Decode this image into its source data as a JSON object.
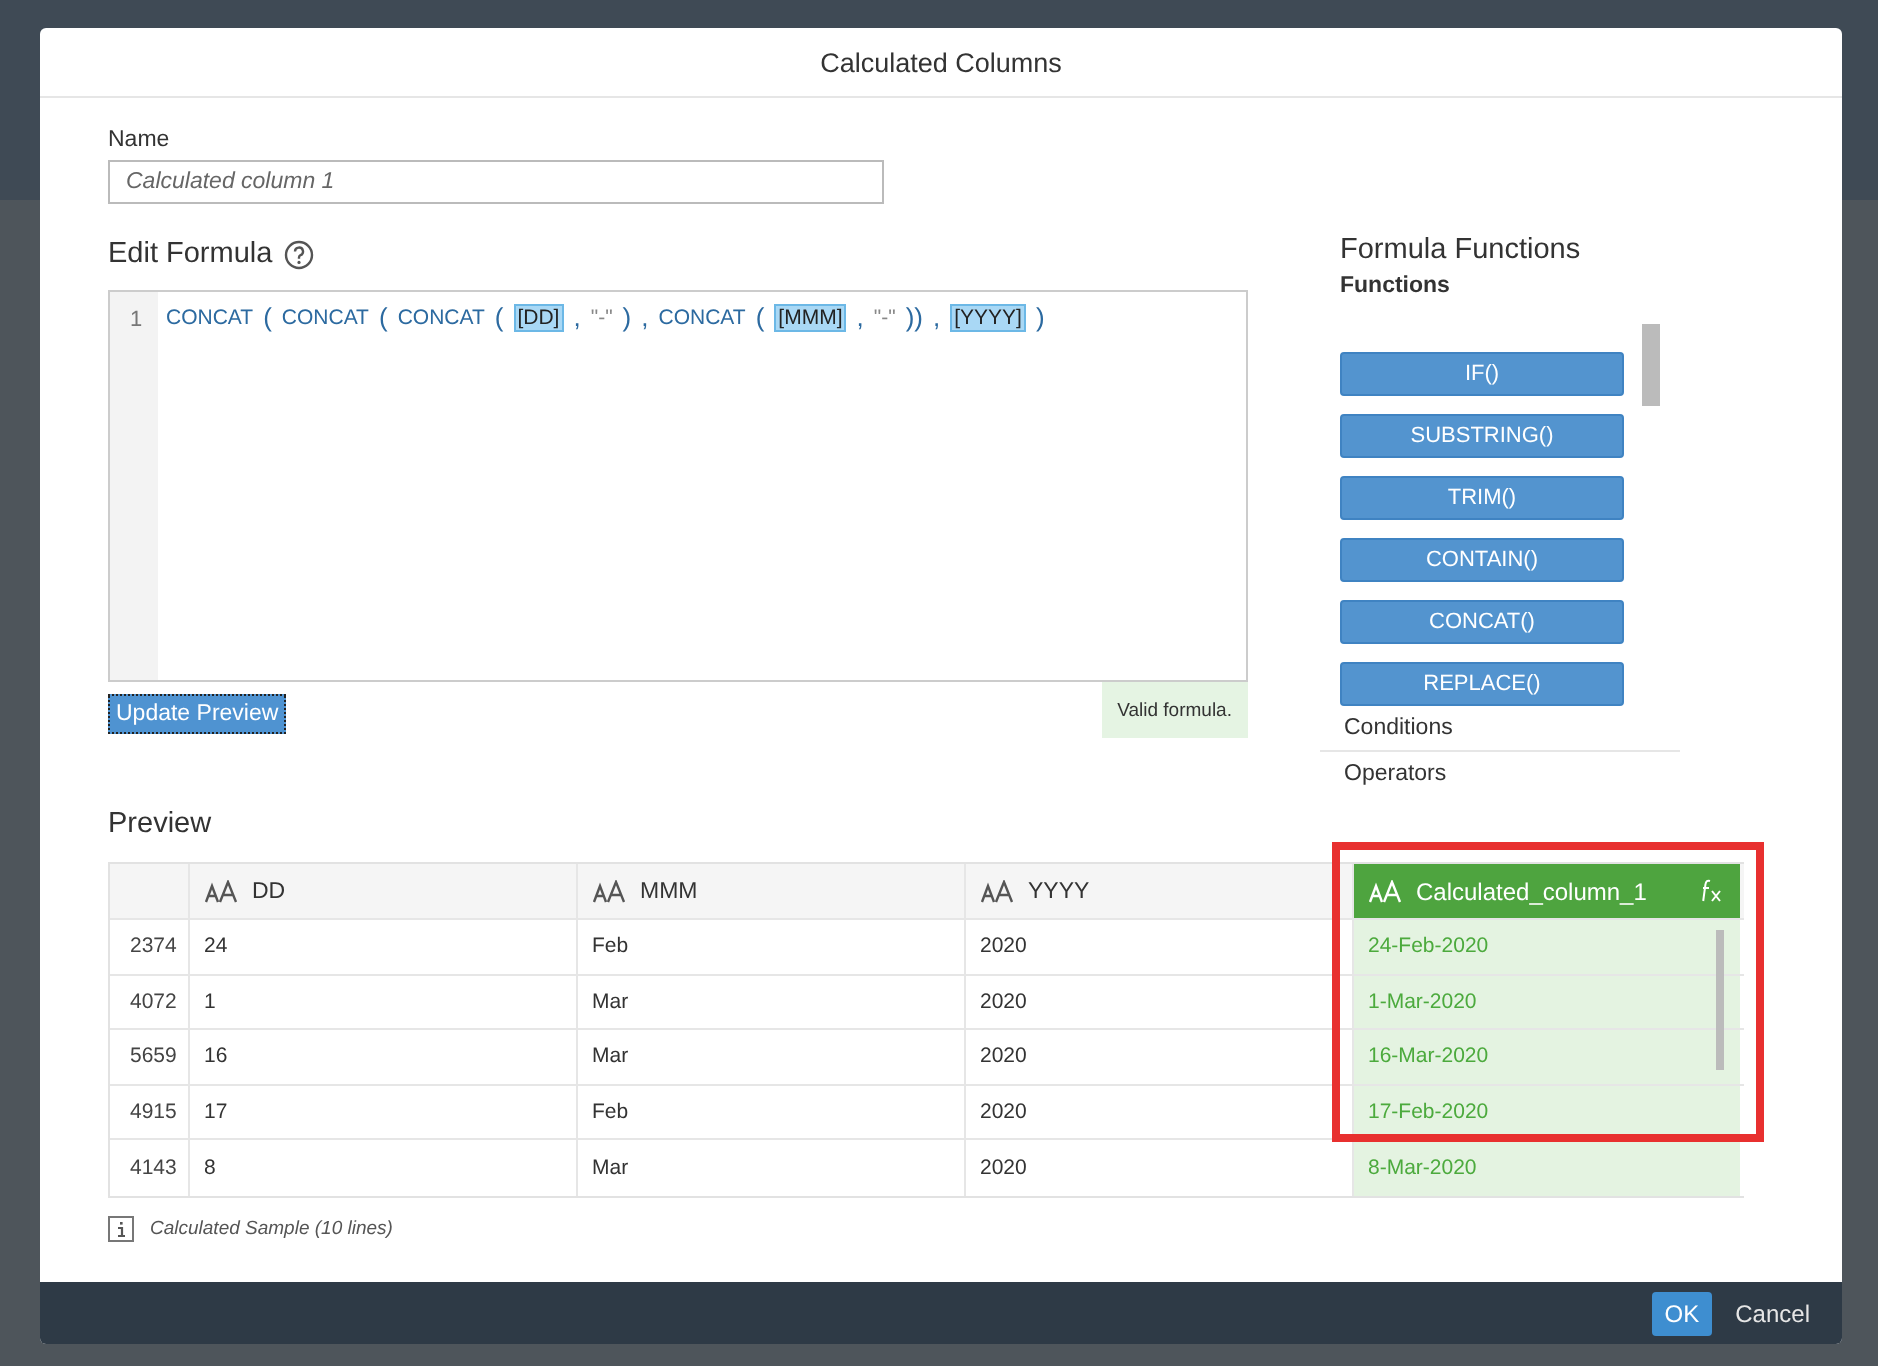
{
  "dialog": {
    "title": "Calculated Columns"
  },
  "name_field": {
    "label": "Name",
    "placeholder": "Calculated column 1"
  },
  "formula": {
    "heading": "Edit Formula",
    "line_number": "1",
    "tokens": [
      {
        "kind": "function",
        "text": "CONCAT"
      },
      {
        "kind": "punct",
        "text": "("
      },
      {
        "kind": "function",
        "text": "CONCAT"
      },
      {
        "kind": "punct",
        "text": "("
      },
      {
        "kind": "function",
        "text": "CONCAT"
      },
      {
        "kind": "punct",
        "text": "("
      },
      {
        "kind": "field",
        "text": "[DD]"
      },
      {
        "kind": "punct",
        "text": ","
      },
      {
        "kind": "string",
        "text": "\"-\""
      },
      {
        "kind": "punct",
        "text": ")"
      },
      {
        "kind": "punct",
        "text": ","
      },
      {
        "kind": "function",
        "text": "CONCAT"
      },
      {
        "kind": "punct",
        "text": "("
      },
      {
        "kind": "field",
        "text": "[MMM]"
      },
      {
        "kind": "punct",
        "text": ","
      },
      {
        "kind": "string",
        "text": "\"-\""
      },
      {
        "kind": "punct",
        "text": "))"
      },
      {
        "kind": "punct",
        "text": ","
      },
      {
        "kind": "field",
        "text": "[YYYY]"
      },
      {
        "kind": "punct",
        "text": ")"
      }
    ],
    "update_button": "Update Preview",
    "status": "Valid formula."
  },
  "functions_panel": {
    "heading": "Formula Functions",
    "subheading": "Functions",
    "buttons": [
      "IF()",
      "SUBSTRING()",
      "TRIM()",
      "CONTAIN()",
      "CONCAT()",
      "REPLACE()"
    ],
    "sections": [
      "Conditions",
      "Operators"
    ]
  },
  "preview": {
    "heading": "Preview",
    "columns": [
      {
        "label": "DD",
        "kind": "source"
      },
      {
        "label": "MMM",
        "kind": "source"
      },
      {
        "label": "YYYY",
        "kind": "source"
      },
      {
        "label": "Calculated_column_1",
        "kind": "calculated"
      }
    ],
    "rows": [
      {
        "index": "2374",
        "cells": [
          "24",
          "Feb",
          "2020",
          "24-Feb-2020"
        ]
      },
      {
        "index": "4072",
        "cells": [
          "1",
          "Mar",
          "2020",
          "1-Mar-2020"
        ]
      },
      {
        "index": "5659",
        "cells": [
          "16",
          "Mar",
          "2020",
          "16-Mar-2020"
        ]
      },
      {
        "index": "4915",
        "cells": [
          "17",
          "Feb",
          "2020",
          "17-Feb-2020"
        ]
      },
      {
        "index": "4143",
        "cells": [
          "8",
          "Mar",
          "2020",
          "8-Mar-2020"
        ]
      }
    ],
    "footnote": "Calculated Sample (10 lines)"
  },
  "footer": {
    "buttons": [
      {
        "label": "OK",
        "kind": "primary"
      },
      {
        "label": "Cancel",
        "kind": "plain"
      }
    ]
  }
}
